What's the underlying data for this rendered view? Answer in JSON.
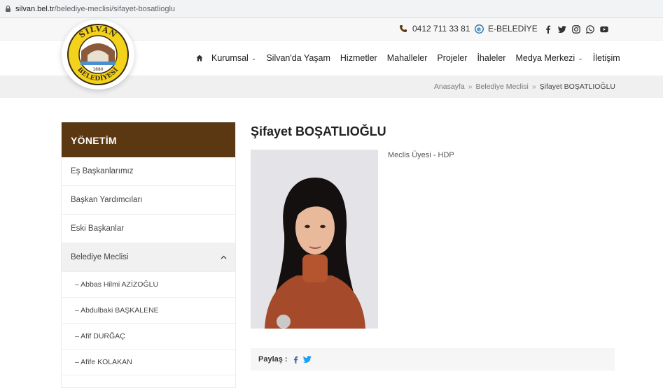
{
  "browser": {
    "url_domain": "silvan.bel.tr",
    "url_path": "/belediye-meclisi/sifayet-bosatlioglu"
  },
  "topbar": {
    "phone": "0412 711 33 81",
    "ebelediye": "E-BELEDİYE",
    "social_icons": [
      "facebook-icon",
      "twitter-icon",
      "instagram-icon",
      "whatsapp-icon",
      "youtube-icon"
    ]
  },
  "logo": {
    "top_text": "SİLVAN",
    "bottom_text": "BELEDİYESİ",
    "year": "1880"
  },
  "nav": {
    "items": [
      {
        "label": "Kurumsal",
        "dropdown": true
      },
      {
        "label": "Silvan'da Yaşam",
        "dropdown": false
      },
      {
        "label": "Hizmetler",
        "dropdown": false
      },
      {
        "label": "Mahalleler",
        "dropdown": false
      },
      {
        "label": "Projeler",
        "dropdown": false
      },
      {
        "label": "İhaleler",
        "dropdown": false
      },
      {
        "label": "Medya Merkezi",
        "dropdown": true
      },
      {
        "label": "İletişim",
        "dropdown": false
      }
    ]
  },
  "breadcrumb": {
    "items": [
      "Anasayfa",
      "Belediye Meclisi",
      "Şifayet BOŞATLIOĞLU"
    ],
    "separator": "»"
  },
  "sidebar": {
    "title": "YÖNETİM",
    "items": [
      "Eş Başkanlarımız",
      "Başkan Yardımcıları",
      "Eski Başkanlar",
      "Belediye Meclisi"
    ],
    "subitems": [
      "– Abbas Hilmi AZİZOĞLU",
      "– Abdulbaki BAŞKALENE",
      "– Afif DURĞAÇ",
      "– Afife KOLAKAN"
    ]
  },
  "main": {
    "name": "Şifayet BOŞATLIOĞLU",
    "role": "Meclis Üyesi - HDP",
    "share_label": "Paylaş :"
  },
  "colors": {
    "brand_brown": "#5b3811",
    "facebook": "#3b5998",
    "twitter": "#1da1f2",
    "logo_yellow": "#f2d21b"
  }
}
